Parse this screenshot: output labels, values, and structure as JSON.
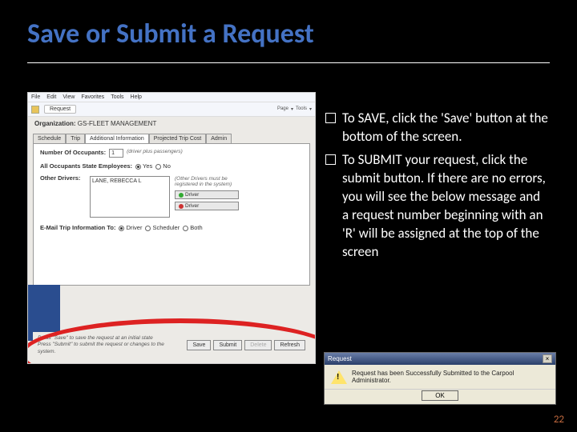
{
  "slide": {
    "title": "Save or Submit a Request",
    "page_number": "22"
  },
  "bullets": [
    "To SAVE, click the 'Save' button at the bottom of the screen.",
    "To SUBMIT your request, click the submit button.  If there are no errors, you will see the below message and a request number beginning with an 'R' will be assigned at the top of the screen"
  ],
  "app": {
    "menubar": [
      "File",
      "Edit",
      "View",
      "Favorites",
      "Tools",
      "Help"
    ],
    "toolbar_tab": "Request",
    "toolbar_right_items": [
      "Page",
      "Tools"
    ],
    "org_label": "Organization:",
    "org_value": "GS-FLEET MANAGEMENT",
    "tabs": [
      "Schedule",
      "Trip",
      "Additional Information",
      "Projected Trip Cost",
      "Admin"
    ],
    "active_tab_index": 2,
    "fields": {
      "num_occ_label": "Number Of Occupants:",
      "num_occ_value": "1",
      "num_occ_helper": "(driver plus passengers)",
      "state_emp_label": "All Occupants State Employees:",
      "state_emp_options": [
        "Yes",
        "No"
      ],
      "state_emp_selected": "Yes",
      "other_drivers_label": "Other Drivers:",
      "other_drivers_value": "LANE, REBECCA L",
      "other_drivers_helper": "(Other Drivers must be registered in the system)",
      "driver_add_btn": "Driver",
      "driver_remove_btn": "Driver",
      "email_label": "E-Mail Trip Information To:",
      "email_options": [
        "Driver",
        "Scheduler",
        "Both"
      ],
      "email_selected": "Driver"
    },
    "footer": {
      "hint_line1": "Press \"Save\" to save the request at an initial state",
      "hint_line2": "Press \"Submit\" to submit the request or changes to the system.",
      "buttons": {
        "save": "Save",
        "submit": "Submit",
        "delete": "Delete",
        "refresh": "Refresh"
      }
    }
  },
  "dialog": {
    "title": "Request",
    "message": "Request has been Successfully Submitted to the Carpool Administrator.",
    "ok": "OK"
  }
}
